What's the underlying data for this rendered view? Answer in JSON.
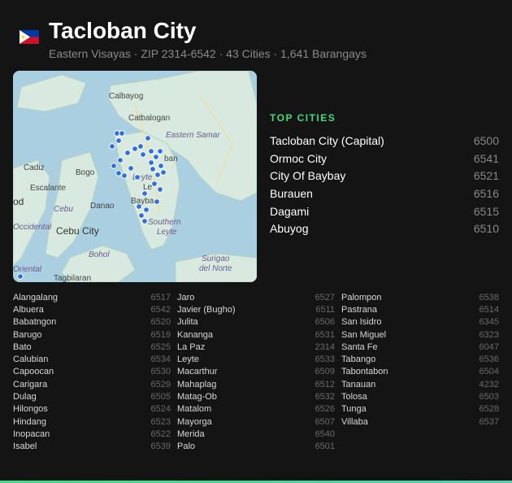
{
  "header": {
    "title": "Tacloban City",
    "subtitle": "Eastern Visayas · ZIP 2314-6542 · 43 Cities · 1,641 Barangays"
  },
  "map": {
    "labels": [
      "Calbayog",
      "Catbalogan",
      "Eastern Samar",
      "Cadiz",
      "Bogo",
      "Escalante",
      "Cebu",
      "Danao",
      "Cebu City",
      "Bayba",
      "Southern Leyte",
      "Bohol",
      "Surigao del Norte",
      "Tagbilaran",
      "Oriental",
      "Occidental",
      "Leyte",
      "Le",
      "ban",
      "od"
    ]
  },
  "top_cities": {
    "heading": "TOP CITIES",
    "items": [
      {
        "name": "Tacloban City (Capital)",
        "zip": "6500"
      },
      {
        "name": "Ormoc City",
        "zip": "6541"
      },
      {
        "name": "City Of Baybay",
        "zip": "6521"
      },
      {
        "name": "Burauen",
        "zip": "6516"
      },
      {
        "name": "Dagami",
        "zip": "6515"
      },
      {
        "name": "Abuyog",
        "zip": "6510"
      }
    ]
  },
  "city_list": {
    "columns": [
      [
        {
          "name": "Alangalang",
          "zip": "6517"
        },
        {
          "name": "Albuera",
          "zip": "6542"
        },
        {
          "name": "Babatngon",
          "zip": "6520"
        },
        {
          "name": "Barugo",
          "zip": "6519"
        },
        {
          "name": "Bato",
          "zip": "6525"
        },
        {
          "name": "Calubian",
          "zip": "6534"
        },
        {
          "name": "Capoocan",
          "zip": "6530"
        },
        {
          "name": "Carigara",
          "zip": "6529"
        },
        {
          "name": "Dulag",
          "zip": "6505"
        },
        {
          "name": "Hilongos",
          "zip": "6524"
        },
        {
          "name": "Hindang",
          "zip": "6523"
        },
        {
          "name": "Inopacan",
          "zip": "6522"
        },
        {
          "name": "Isabel",
          "zip": "6539"
        }
      ],
      [
        {
          "name": "Jaro",
          "zip": "6527"
        },
        {
          "name": "Javier (Bugho)",
          "zip": "6511"
        },
        {
          "name": "Julita",
          "zip": "6506"
        },
        {
          "name": "Kananga",
          "zip": "6531"
        },
        {
          "name": "La Paz",
          "zip": "2314"
        },
        {
          "name": "Leyte",
          "zip": "6533"
        },
        {
          "name": "Macarthur",
          "zip": "6509"
        },
        {
          "name": "Mahaplag",
          "zip": "6512"
        },
        {
          "name": "Matag-Ob",
          "zip": "6532"
        },
        {
          "name": "Matalom",
          "zip": "6526"
        },
        {
          "name": "Mayorga",
          "zip": "6507"
        },
        {
          "name": "Merida",
          "zip": "6540"
        },
        {
          "name": "Palo",
          "zip": "6501"
        }
      ],
      [
        {
          "name": "Palompon",
          "zip": "6538"
        },
        {
          "name": "Pastrana",
          "zip": "6514"
        },
        {
          "name": "San Isidro",
          "zip": "6345"
        },
        {
          "name": "San Miguel",
          "zip": "6323"
        },
        {
          "name": "Santa Fe",
          "zip": "6047"
        },
        {
          "name": "Tabango",
          "zip": "6536"
        },
        {
          "name": "Tabontabon",
          "zip": "6504"
        },
        {
          "name": "Tanauan",
          "zip": "4232"
        },
        {
          "name": "Tolosa",
          "zip": "6503"
        },
        {
          "name": "Tunga",
          "zip": "6528"
        },
        {
          "name": "Villaba",
          "zip": "6537"
        }
      ]
    ]
  },
  "colors": {
    "accent": "#3ddc84",
    "background": "#141414",
    "marker": "#2f6fe0"
  }
}
